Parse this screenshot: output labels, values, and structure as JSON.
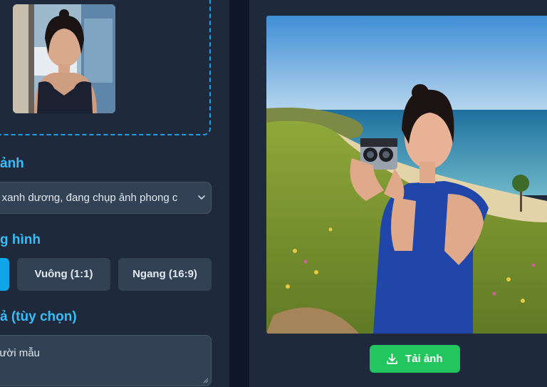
{
  "upload": {
    "thumbnail_alt": "uploaded portrait"
  },
  "scene": {
    "label": "ảnh",
    "selected": "y xanh dương, đang chụp ảnh phong c"
  },
  "aspect": {
    "label": "g hình",
    "options": [
      {
        "label": "",
        "active": true
      },
      {
        "label": "Vuông (1:1)",
        "active": false
      },
      {
        "label": "Ngang (16:9)",
        "active": false
      }
    ]
  },
  "description": {
    "label": "ả (tùy chọn)",
    "value": "gười mẫu"
  },
  "result": {
    "download_label": "Tải ảnh"
  },
  "colors": {
    "accent": "#38bdf8",
    "active": "#0ea5e9",
    "download": "#22c55e",
    "panel": "#1e293b",
    "background": "#0f172a"
  }
}
